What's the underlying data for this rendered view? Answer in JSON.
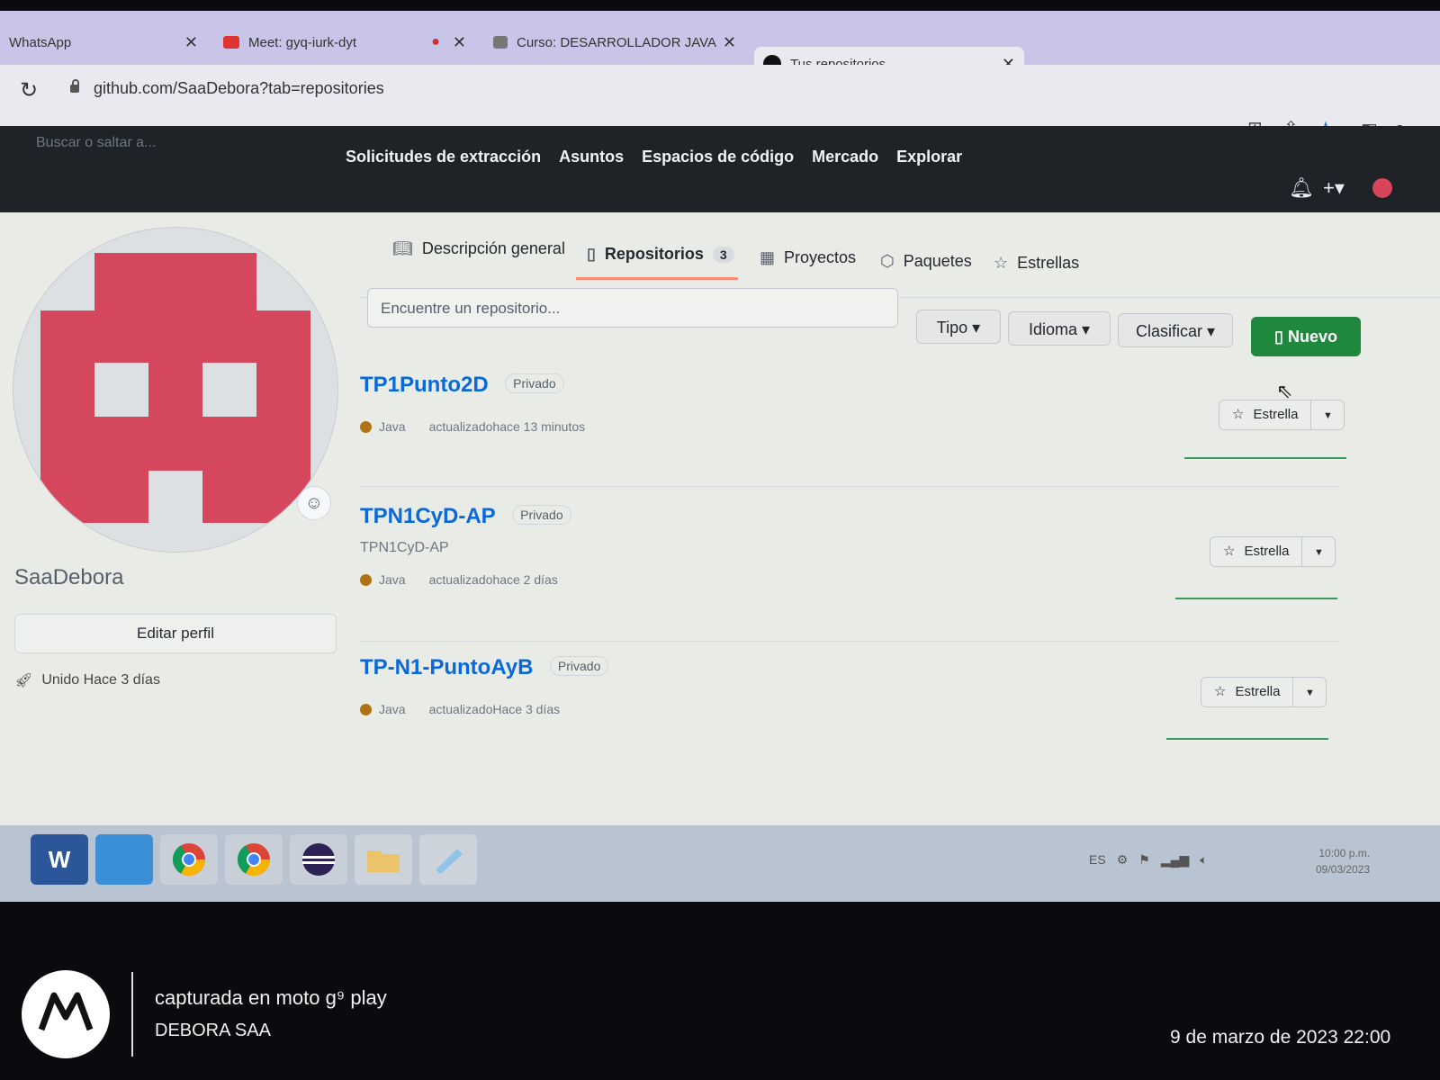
{
  "browser": {
    "tabs": [
      {
        "title": "WhatsApp",
        "active": false
      },
      {
        "title": "Meet: gyq-iurk-dyt",
        "active": false
      },
      {
        "title": "Curso: DESARROLLADOR JAVA IN",
        "active": false
      },
      {
        "title": "Tus repositorios",
        "active": true
      }
    ],
    "url": "github.com/SaaDebora?tab=repositories"
  },
  "github": {
    "search_placeholder": "Buscar o saltar a...",
    "nav": [
      "Solicitudes de extracción",
      "Asuntos",
      "Espacios de código",
      "Mercado",
      "Explorar"
    ]
  },
  "profile": {
    "username": "SaaDebora",
    "edit_label": "Editar perfil",
    "joined": "Unido Hace 3 días",
    "tabs": {
      "overview": "Descripción general",
      "repos": "Repositorios",
      "repos_count": "3",
      "projects": "Proyectos",
      "packages": "Paquetes",
      "stars": "Estrellas"
    }
  },
  "filters": {
    "search_placeholder": "Encuentre un repositorio...",
    "type": "Tipo",
    "language": "Idioma",
    "sort": "Clasificar",
    "new": "Nuevo"
  },
  "repos": [
    {
      "name": "TP1Punto2D",
      "visibility": "Privado",
      "description": "",
      "language": "Java",
      "updated": "actualizadohace 13 minutos",
      "star_label": "Estrella"
    },
    {
      "name": "TPN1CyD-AP",
      "visibility": "Privado",
      "description": "TPN1CyD-AP",
      "language": "Java",
      "updated": "actualizadohace 2 días",
      "star_label": "Estrella"
    },
    {
      "name": "TP-N1-PuntoAyB",
      "visibility": "Privado",
      "description": "",
      "language": "Java",
      "updated": "actualizadoHace 3 días",
      "star_label": "Estrella"
    }
  ],
  "taskbar": {
    "apps": [
      "W"
    ],
    "tray_lang": "ES",
    "time": "10:00 p.m.",
    "date": "09/03/2023"
  },
  "photo_caption": {
    "device": "capturada en moto g⁹ play",
    "author": "DEBORA SAA",
    "datetime": "9 de marzo de 2023 22:00"
  },
  "colors": {
    "link": "#0969da",
    "primary_button": "#1f883d",
    "java": "#b07219",
    "tab_underline": "#fd8c73",
    "avatar": "#d5475c"
  }
}
